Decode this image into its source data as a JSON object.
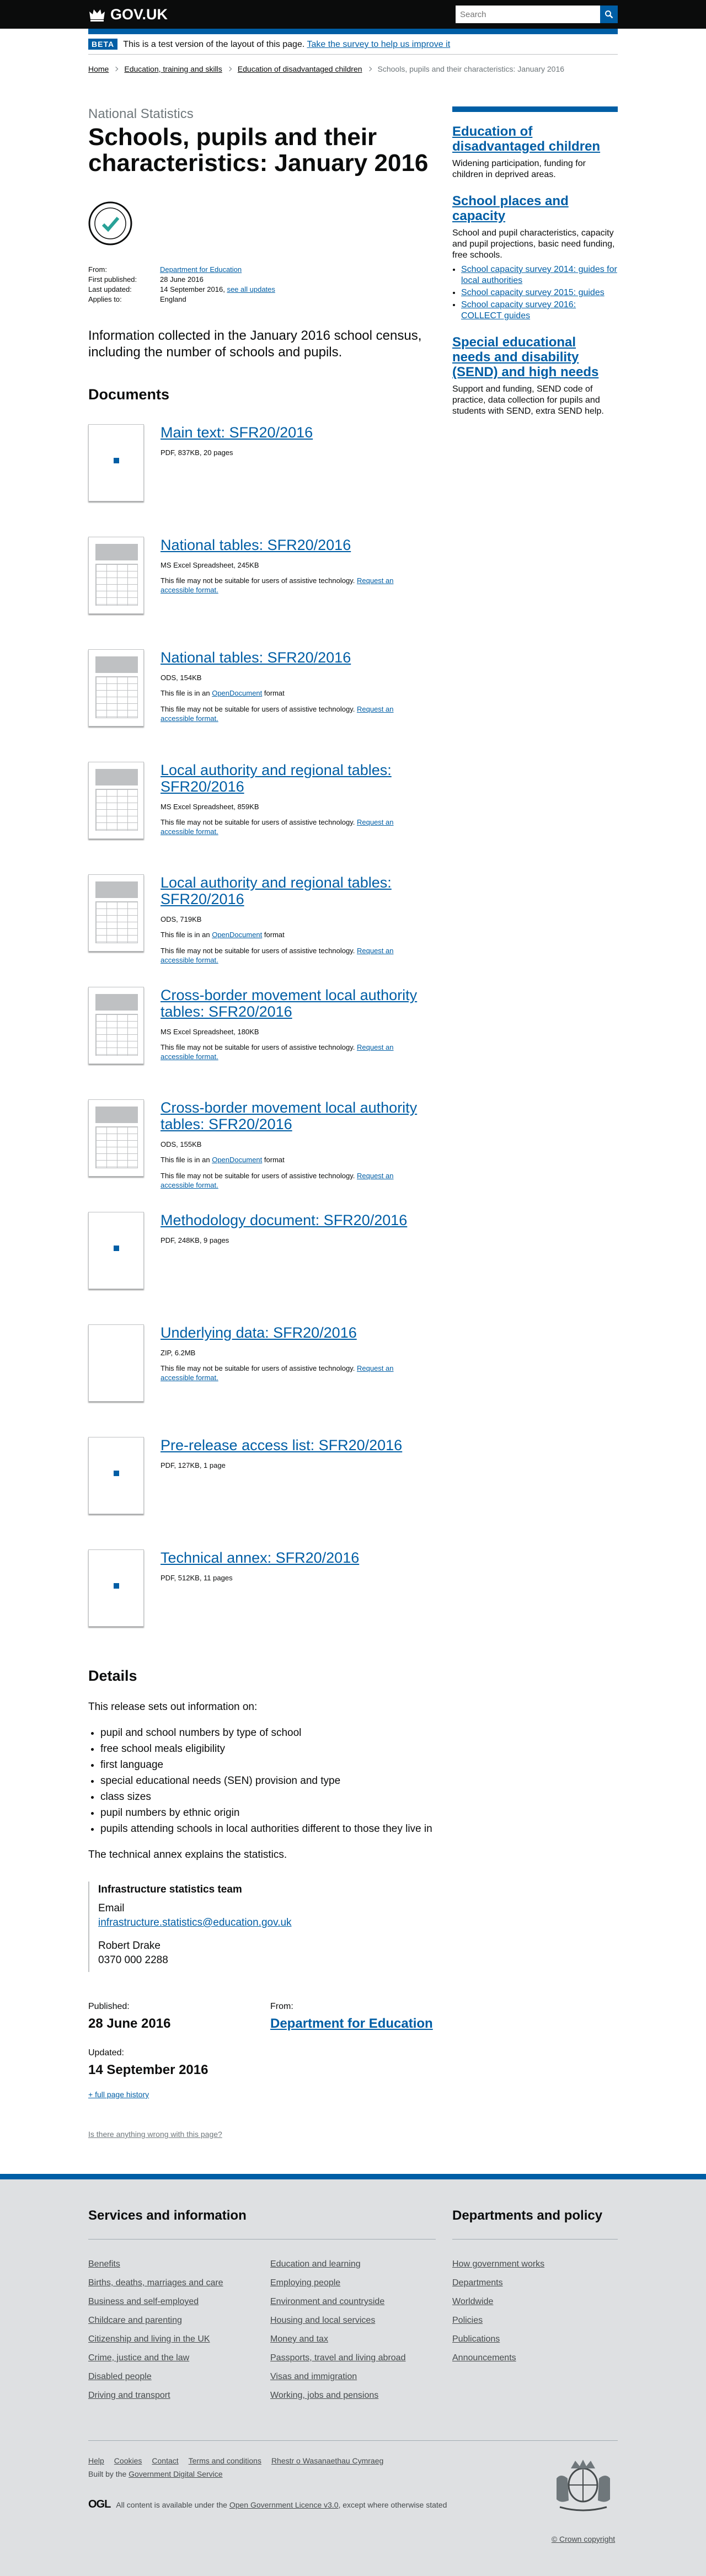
{
  "header": {
    "logo_text": "GOV.UK",
    "search_placeholder": "Search"
  },
  "beta": {
    "tag": "BETA",
    "text": "This is a test version of the layout of this page.",
    "link": "Take the survey to help us improve it"
  },
  "breadcrumbs": [
    "Home",
    "Education, training and skills",
    "Education of disadvantaged children",
    "Schools, pupils and their characteristics: January 2016"
  ],
  "page": {
    "subtitle": "National Statistics",
    "title": "Schools, pupils and their characteristics: January 2016",
    "meta": {
      "from_label": "From:",
      "from_value": "Department for Education",
      "first_published_label": "First published:",
      "first_published_value": "28 June 2016",
      "last_updated_label": "Last updated:",
      "last_updated_value": "14 September 2016,",
      "see_all_updates": "see all updates",
      "applies_label": "Applies to:",
      "applies_value": "England"
    },
    "description": "Information collected in the January 2016 school census, including the number of schools and pupils."
  },
  "documents": {
    "heading": "Documents",
    "accessible_note": "This file may not be suitable for users of assistive technology.",
    "accessible_link": "Request an accessible format.",
    "odf_prefix": "This file is in an",
    "odf_link": "OpenDocument",
    "odf_suffix": "format",
    "items": [
      {
        "title": "Main text: SFR20/2016",
        "meta": "PDF, 837KB, 20 pages",
        "kind": "pdf"
      },
      {
        "title": "National tables: SFR20/2016",
        "meta": "MS Excel Spreadsheet, 245KB",
        "kind": "sheet"
      },
      {
        "title": "National tables: SFR20/2016",
        "meta": "ODS, 154KB",
        "kind": "ods"
      },
      {
        "title": "Local authority and regional tables: SFR20/2016",
        "meta": "MS Excel Spreadsheet, 859KB",
        "kind": "sheet"
      },
      {
        "title": "Local authority and regional tables: SFR20/2016",
        "meta": "ODS, 719KB",
        "kind": "ods"
      },
      {
        "title": "Cross-border movement local authority tables: SFR20/2016",
        "meta": "MS Excel Spreadsheet, 180KB",
        "kind": "sheet"
      },
      {
        "title": "Cross-border movement local authority tables: SFR20/2016",
        "meta": "ODS, 155KB",
        "kind": "ods"
      },
      {
        "title": "Methodology document: SFR20/2016",
        "meta": "PDF, 248KB, 9 pages",
        "kind": "pdf"
      },
      {
        "title": "Underlying data: SFR20/2016",
        "meta": "ZIP, 6.2MB",
        "kind": "zip"
      },
      {
        "title": "Pre-release access list: SFR20/2016",
        "meta": "PDF, 127KB, 1 page",
        "kind": "pdf"
      },
      {
        "title": "Technical annex: SFR20/2016",
        "meta": "PDF, 512KB, 11 pages",
        "kind": "pdf"
      }
    ]
  },
  "details": {
    "heading": "Details",
    "intro": "This release sets out information on:",
    "list": [
      "pupil and school numbers by type of school",
      "free school meals eligibility",
      "first language",
      "special educational needs (SEN) provision and type",
      "class sizes",
      "pupil numbers by ethnic origin",
      "pupils attending schools in local authorities different to those they live in"
    ],
    "annex_text": "The technical annex explains the statistics.",
    "contact": {
      "team": "Infrastructure statistics team",
      "email_label": "Email",
      "email": "infrastructure.statistics@education.gov.uk",
      "name": "Robert Drake",
      "phone": "0370 000 2288"
    }
  },
  "publication": {
    "published_label": "Published:",
    "published_value": "28 June 2016",
    "from_label": "From:",
    "from_value": "Department for Education",
    "updated_label": "Updated:",
    "updated_value": "14 September 2016",
    "history_link": "+ full page history",
    "wrong_link": "Is there anything wrong with this page?"
  },
  "sidebar": {
    "groups": [
      {
        "title": "Education of disadvantaged children",
        "text": "Widening participation, funding for children in deprived areas.",
        "links": []
      },
      {
        "title": "School places and capacity",
        "text": "School and pupil characteristics, capacity and pupil projections, basic need funding, free schools.",
        "links": [
          "School capacity survey 2014: guides for local authorities",
          "School capacity survey 2015: guides",
          "School capacity survey 2016: COLLECT guides"
        ]
      },
      {
        "title": "Special educational needs and disability (SEND) and high needs",
        "text": "Support and funding, SEND code of practice, data collection for pupils and students with SEND, extra SEND help.",
        "links": []
      }
    ]
  },
  "footer": {
    "services_heading": "Services and information",
    "services": [
      "Benefits",
      "Education and learning",
      "Births, deaths, marriages and care",
      "Employing people",
      "Business and self-employed",
      "Environment and countryside",
      "Childcare and parenting",
      "Housing and local services",
      "Citizenship and living in the UK",
      "Money and tax",
      "Crime, justice and the law",
      "Passports, travel and living abroad",
      "Disabled people",
      "Visas and immigration",
      "Driving and transport",
      "Working, jobs and pensions"
    ],
    "dept_heading": "Departments and policy",
    "dept_links": [
      "How government works",
      "Departments",
      "Worldwide",
      "Policies",
      "Publications",
      "Announcements"
    ],
    "meta_links": [
      "Help",
      "Cookies",
      "Contact",
      "Terms and conditions",
      "Rhestr o Wasanaethau Cymraeg"
    ],
    "built_by_prefix": "Built by the",
    "built_by_link": "Government Digital Service",
    "ogl": "OGL",
    "licence_prefix": "All content is available under the",
    "licence_link": "Open Government Licence v3.0",
    "licence_suffix": ", except where otherwise stated",
    "copyright": "© Crown copyright"
  }
}
